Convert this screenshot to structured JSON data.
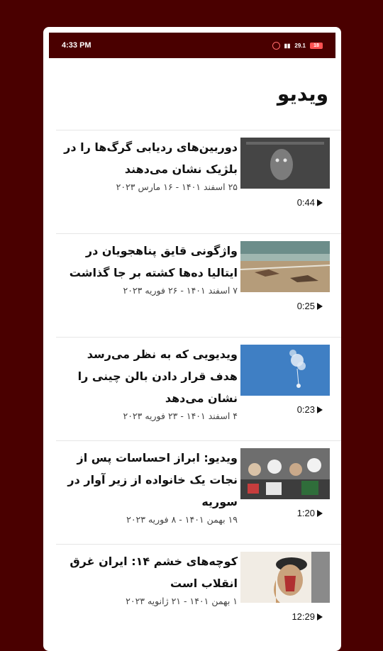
{
  "status_bar": {
    "time": "4:33 PM",
    "battery": "18",
    "net": "29.1"
  },
  "page": {
    "title": "ویدیو"
  },
  "items": [
    {
      "title": "دوربین‌های ردیابی گرگ‌ها را در بلژیک نشان می‌دهند",
      "date": "۲۵ اسفند ۱۴۰۱ - ۱۶ مارس ۲۰۲۳",
      "duration": "0:44",
      "thumb_icon": "wolf-night-camera-image"
    },
    {
      "title": "واژگونی قایق پناهجویان در ایتالیا ده‌ها کشته بر جا گذاشت",
      "date": "۷ اسفند ۱۴۰۱ - ۲۶ فوریه ۲۰۲۳",
      "duration": "0:25",
      "thumb_icon": "beach-wreckage-image"
    },
    {
      "title": "ویدیویی که به نظر می‌رسد هدف قرار دادن بالن چینی را نشان می‌دهد",
      "date": "۴ اسفند ۱۴۰۱ - ۲۳ فوریه ۲۰۲۳",
      "duration": "0:23",
      "thumb_icon": "balloon-sky-image"
    },
    {
      "title": "ویدیو: ابراز احساسات پس از نجات یک خانواده از زیر آوار در سوریه",
      "date": "۱۹ بهمن ۱۴۰۱ - ۸ فوریه ۲۰۲۳",
      "duration": "1:20",
      "thumb_icon": "rescue-crowd-image"
    },
    {
      "title": "کوچه‌های خشم ۱۴: ایران غرق انقلاب است",
      "date": "۱ بهمن ۱۴۰۱ - ۲۱ ژانویه ۲۰۲۳",
      "duration": "12:29",
      "thumb_icon": "painted-face-image"
    }
  ]
}
